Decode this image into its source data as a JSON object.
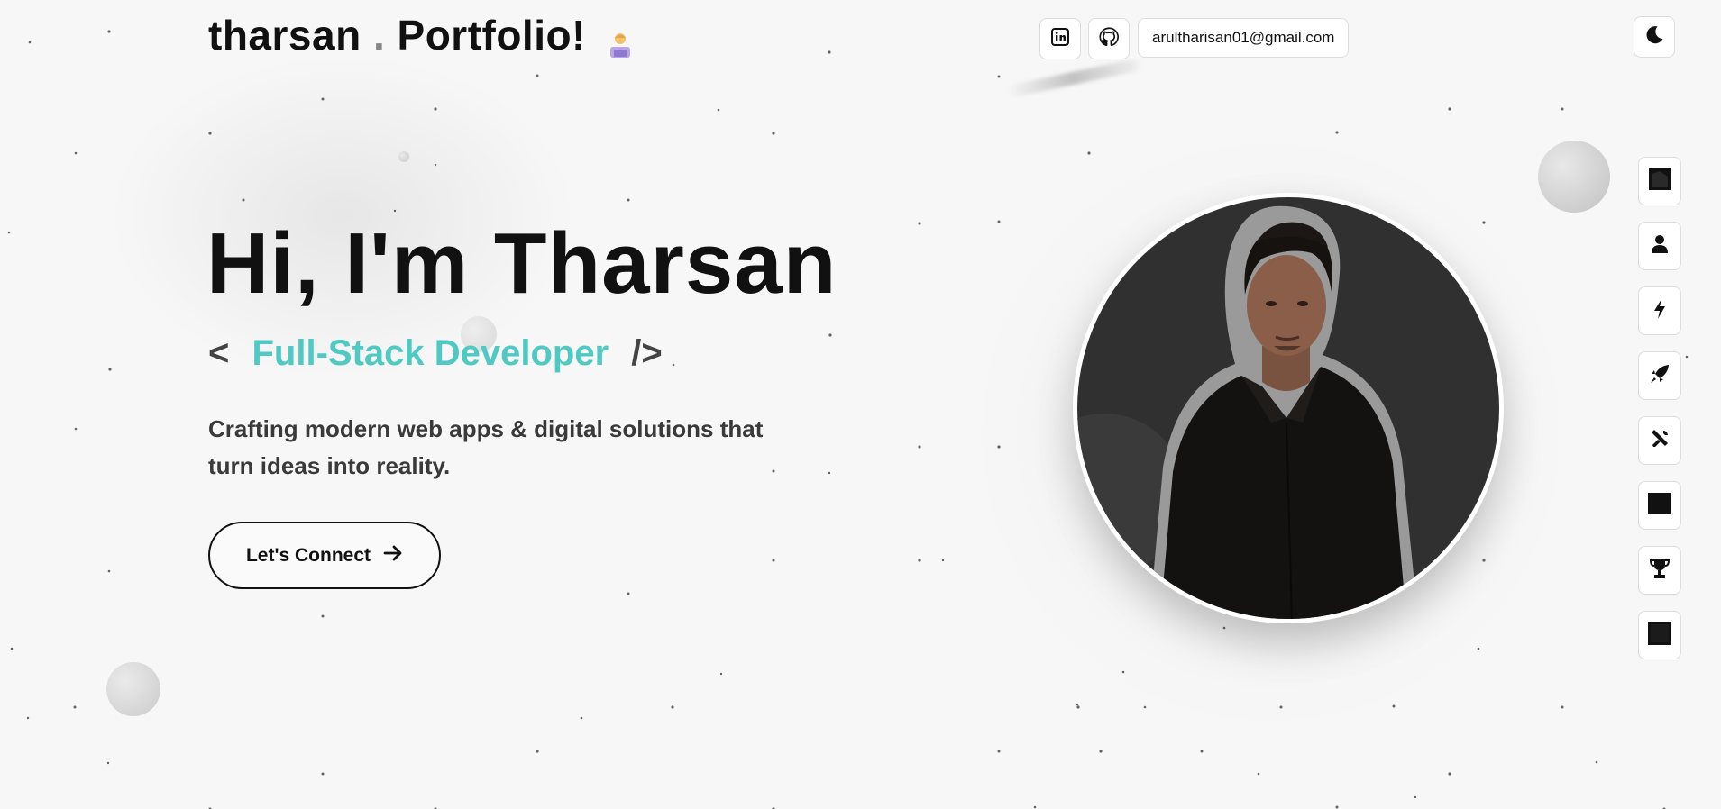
{
  "header": {
    "brand_name": "tharsan",
    "brand_dot": ".",
    "brand_suffix": "Portfolio!",
    "email": "arultharisan01@gmail.com",
    "icons": [
      "linkedin-icon",
      "github-icon",
      "moon-icon"
    ]
  },
  "hero": {
    "title": "Hi, I'm Tharsan",
    "role_open": "<",
    "role": "Full-Stack Developer",
    "role_close": "/>",
    "tagline": "Crafting modern web apps & digital solutions that turn ideas into reality.",
    "cta_label": "Let's Connect"
  },
  "side_nav": {
    "icons": [
      "home-icon",
      "user-icon",
      "lightning-icon",
      "rocket-icon",
      "tools-icon",
      "projects-icon",
      "trophy-icon",
      "contact-icon"
    ]
  },
  "colors": {
    "accent": "#4fc9c2",
    "background": "#f7f7f7",
    "text": "#111111"
  }
}
